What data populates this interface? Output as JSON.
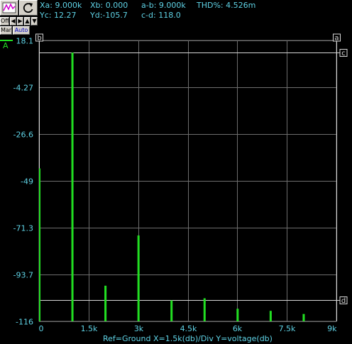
{
  "toolbar": {
    "scope_icon": "waveform-icon",
    "reset_icon": "refresh-icon",
    "off_label": "Off",
    "man_label": "Man",
    "auto_label": "Auto",
    "arrow_icons": [
      "arrow-left-icon",
      "arrow-right-icon",
      "arrow-up-icon",
      "arrow-down-icon"
    ]
  },
  "readouts": {
    "xa": "Xa: 9.000k",
    "xb": "Xb: 0.000",
    "ab": "a-b: 9.000k",
    "thd": "THD%: 4.526m",
    "yc": "Yc: 12.27",
    "yd": "Yd:-105.7",
    "cd": "c-d: 118.0"
  },
  "channel_label": "A",
  "cursor_labels": {
    "a": "a",
    "b": "b",
    "c": "c",
    "d": "d"
  },
  "footer": "Ref=Ground  X=1.5k(db)/Div Y=voltage(db)",
  "colors": {
    "background": "#000000",
    "grid": "#6e6e6e",
    "trace": "#22e022",
    "text": "#5fd3e6",
    "cursor_line": "#d8d8d8"
  },
  "chart_data": {
    "type": "bar",
    "xlabel": "Ref=Ground  X=1.5k(db)/Div Y=voltage(db)",
    "ylabel": "",
    "xlim": [
      0,
      9000
    ],
    "ylim": [
      -116,
      18.1
    ],
    "x_ticks": [
      {
        "value": 0,
        "label": "0"
      },
      {
        "value": 1500,
        "label": "1.5k"
      },
      {
        "value": 3000,
        "label": "3k"
      },
      {
        "value": 4500,
        "label": "4.5k"
      },
      {
        "value": 6000,
        "label": "6k"
      },
      {
        "value": 7500,
        "label": "7.5k"
      },
      {
        "value": 9000,
        "label": "9k"
      }
    ],
    "y_ticks": [
      {
        "value": 18.1,
        "label": "18.1"
      },
      {
        "value": -4.27,
        "label": "-4.27"
      },
      {
        "value": -26.6,
        "label": "-26.6"
      },
      {
        "value": -49,
        "label": "-49"
      },
      {
        "value": -71.3,
        "label": "-71.3"
      },
      {
        "value": -93.7,
        "label": "-93.7"
      },
      {
        "value": -116,
        "label": "-116"
      }
    ],
    "grid": true,
    "series": [
      {
        "points": [
          {
            "x": 0,
            "y": -43
          },
          {
            "x": 1000,
            "y": 12.3
          },
          {
            "x": 2000,
            "y": -99
          },
          {
            "x": 3000,
            "y": -75
          },
          {
            "x": 4000,
            "y": -106
          },
          {
            "x": 5000,
            "y": -105
          },
          {
            "x": 6000,
            "y": -110
          },
          {
            "x": 7000,
            "y": -111
          },
          {
            "x": 8000,
            "y": -112.5
          }
        ]
      }
    ],
    "cursors": {
      "xa": 9000,
      "xb": 0,
      "yc": 12.27,
      "yd": -105.7
    }
  }
}
